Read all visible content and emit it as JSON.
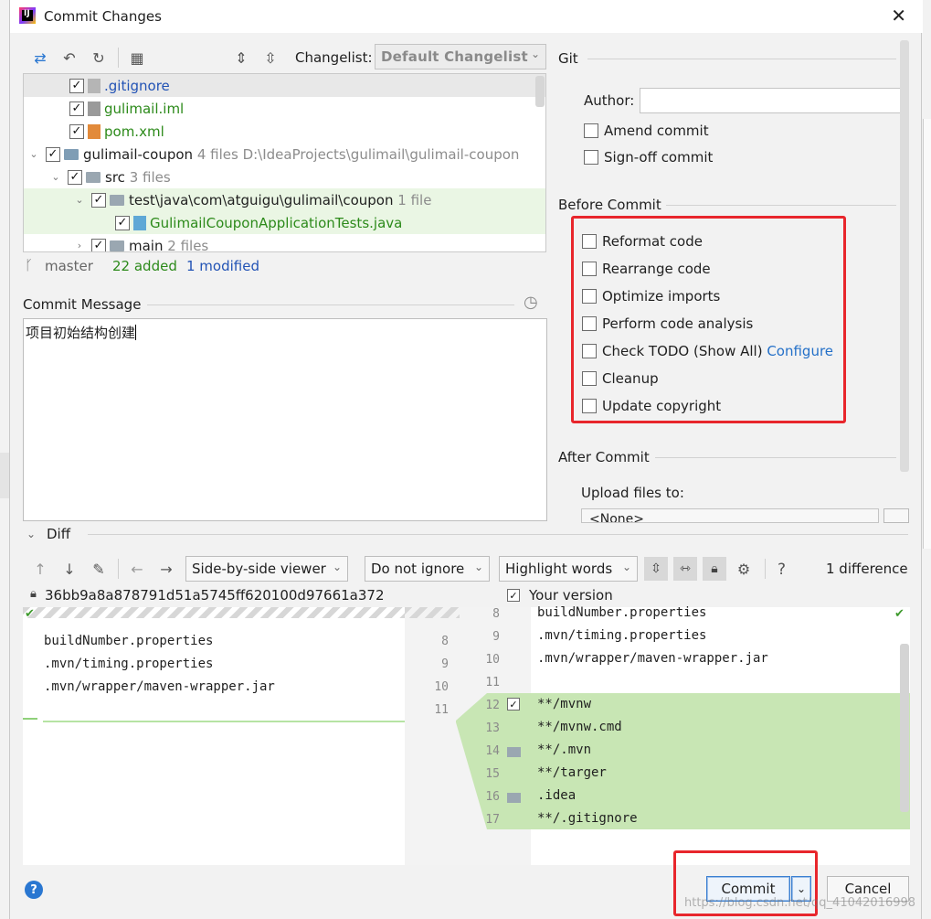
{
  "window": {
    "title": "Commit Changes",
    "close": "✕"
  },
  "toolbar": {
    "changelist_label": "Changelist:",
    "changelist_value": "Default Changelist"
  },
  "tree": {
    "rows": [
      {
        "name": ".gitignore"
      },
      {
        "name": "gulimail.iml"
      },
      {
        "name": "pom.xml"
      },
      {
        "name": "gulimail-coupon",
        "meta": "4 files  D:\\IdeaProjects\\gulimail\\gulimail-coupon"
      },
      {
        "name": "src",
        "meta": "3 files"
      },
      {
        "name": "test\\java\\com\\atguigu\\gulimail\\coupon",
        "meta": "1 file"
      },
      {
        "name": "GulimailCouponApplicationTests.java"
      },
      {
        "name": "main",
        "meta": "2 files"
      }
    ]
  },
  "status": {
    "branch": "master",
    "added": "22 added",
    "modified": "1 modified"
  },
  "commit_message": {
    "label": "Commit Message",
    "value": "项目初始结构创建"
  },
  "git": {
    "section": "Git",
    "author_label": "Author:",
    "amend": "Amend commit",
    "signoff": "Sign-off commit"
  },
  "before_commit": {
    "section": "Before Commit",
    "items": [
      "Reformat code",
      "Rearrange code",
      "Optimize imports",
      "Perform code analysis",
      "Check TODO (Show All)",
      "Cleanup",
      "Update copyright"
    ],
    "configure_link": "Configure"
  },
  "after_commit": {
    "section": "After Commit",
    "upload_label": "Upload files to:",
    "upload_value": "<None>"
  },
  "diff": {
    "label": "Diff",
    "viewer": "Side-by-side viewer",
    "whitespace": "Do not ignore",
    "highlight": "Highlight words",
    "help": "?",
    "difference_count": "1 difference",
    "left_hash": "36bb9a8a878791d51a5745ff620100d97661a372",
    "right_label": "Your version",
    "left_lines": [
      "buildNumber.properties",
      ".mvn/timing.properties",
      ".mvn/wrapper/maven-wrapper.jar"
    ],
    "left_numbers": [
      "8",
      "9",
      "10",
      "11"
    ],
    "right_numbers": [
      "8",
      "9",
      "10",
      "11",
      "12",
      "13",
      "14",
      "15",
      "16",
      "17"
    ],
    "right_lines": [
      "buildNumber.properties",
      ".mvn/timing.properties",
      ".mvn/wrapper/maven-wrapper.jar",
      "",
      "**/mvnw",
      "**/mvnw.cmd",
      "**/.mvn",
      "**/targer",
      ".idea",
      "**/.gitignore"
    ]
  },
  "buttons": {
    "commit": "Commit",
    "cancel": "Cancel",
    "help": "?"
  },
  "watermark": "https://blog.csdn.net/qq_41042016998",
  "colors": {
    "accent": "#2470c8",
    "added_bg": "#c8e6b4",
    "annotation_red": "#e8262c",
    "added_text": "#2c8a1a",
    "modified_text": "#2253b5"
  }
}
